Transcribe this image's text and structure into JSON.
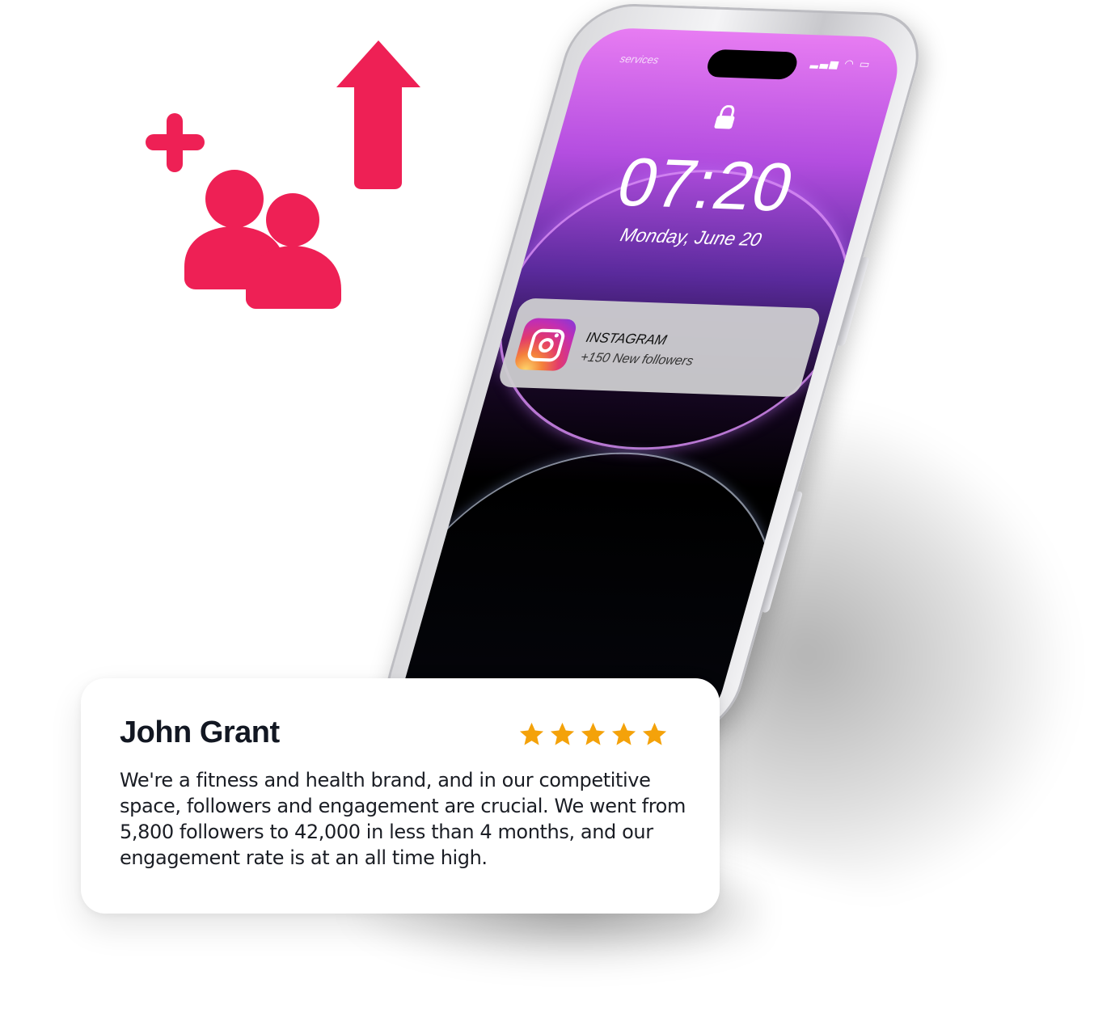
{
  "colors": {
    "accent": "#ee2055",
    "star": "#f4a20a",
    "card_text": "#1a1d24"
  },
  "decorations": {
    "icons": [
      "add-followers-icon",
      "up-arrow-icon"
    ]
  },
  "phone": {
    "carrier": "services",
    "lock_icon": "lock-icon",
    "time": "07:20",
    "date": "Monday, June 20",
    "notification": {
      "app_icon": "instagram-icon",
      "app": "INSTAGRAM",
      "text": "+150 New followers"
    }
  },
  "review": {
    "name": "John Grant",
    "rating": 5,
    "rating_max": 5,
    "text": "We're a fitness and health brand, and in our competitive space, followers and engagement are crucial. We went from 5,800 followers to 42,000 in less than 4 months, and our engagement rate is at an all time high."
  }
}
